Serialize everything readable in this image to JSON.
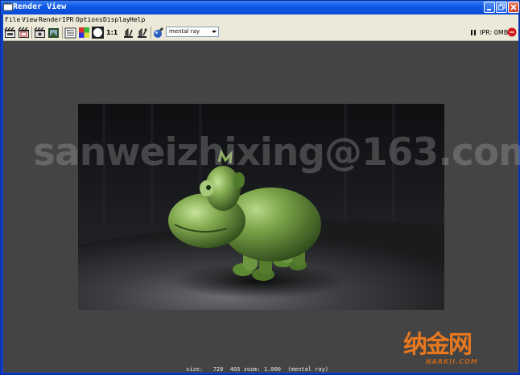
{
  "window": {
    "title": "Render View"
  },
  "menubar": {
    "items": [
      "File",
      "View",
      "Render",
      "IPR",
      "Options",
      "Display",
      "Help"
    ]
  },
  "toolbar": {
    "ratio_label": "1:1",
    "renderer": "mental ray",
    "ipr_status": "IPR: 0MB",
    "icons": [
      "redo-render-icon",
      "render-region-icon",
      "snapshot-icon",
      "keep-image-icon",
      "remove-image-icon",
      "color-channels-icon",
      "alpha-channel-icon",
      "display-settings-icon",
      "render-settings-icon",
      "ipr-tuning-icon",
      "pause-icon",
      "ipr-stop-icon"
    ]
  },
  "viewport": {
    "watermark": "sanweizhixing@163.com",
    "status_line": "size:   720  405 zoom: 1.000  (mental ray)"
  },
  "logo": {
    "main_text": "纳金网",
    "sub_text": "NARKII.COM"
  },
  "colors": {
    "titlebar": "#0a4bd6",
    "chrome": "#ece9d8",
    "viewport_bg": "#444444",
    "render_bg": "#151618",
    "character_green": "#6f9a3e",
    "logo_orange": "#e8781e"
  }
}
